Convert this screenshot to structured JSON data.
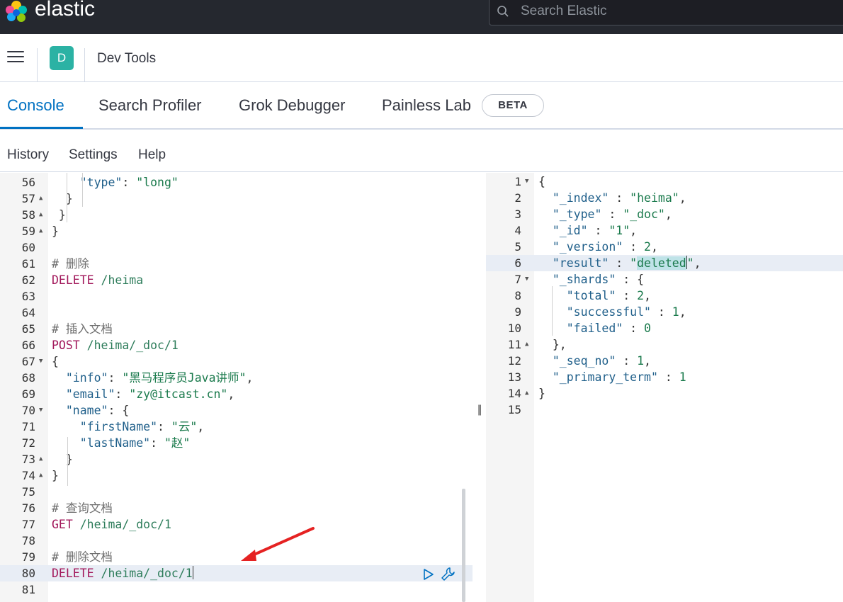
{
  "header": {
    "brand": "elastic",
    "search_placeholder": "Search Elastic"
  },
  "appbar": {
    "avatar_letter": "D",
    "title": "Dev Tools"
  },
  "tabs": [
    {
      "label": "Console",
      "active": true
    },
    {
      "label": "Search Profiler"
    },
    {
      "label": "Grok Debugger"
    },
    {
      "label": "Painless Lab"
    }
  ],
  "beta_badge": "BETA",
  "subnav": [
    "History",
    "Settings",
    "Help"
  ],
  "request_editor": {
    "lines": [
      {
        "n": "56",
        "fold": "",
        "html": "    \"type\": \"long\""
      },
      {
        "n": "57",
        "fold": "▲",
        "html": "  }"
      },
      {
        "n": "58",
        "fold": "▲",
        "html": " }"
      },
      {
        "n": "59",
        "fold": "▲",
        "html": "}"
      },
      {
        "n": "60",
        "fold": "",
        "html": ""
      },
      {
        "n": "61",
        "fold": "",
        "html": "# 删除"
      },
      {
        "n": "62",
        "fold": "",
        "html": "DELETE /heima"
      },
      {
        "n": "63",
        "fold": "",
        "html": ""
      },
      {
        "n": "64",
        "fold": "",
        "html": ""
      },
      {
        "n": "65",
        "fold": "",
        "html": "# 插入文档"
      },
      {
        "n": "66",
        "fold": "",
        "html": "POST /heima/_doc/1"
      },
      {
        "n": "67",
        "fold": "▼",
        "html": "{"
      },
      {
        "n": "68",
        "fold": "",
        "html": "  \"info\": \"黑马程序员Java讲师\","
      },
      {
        "n": "69",
        "fold": "",
        "html": "  \"email\": \"zy@itcast.cn\","
      },
      {
        "n": "70",
        "fold": "▼",
        "html": "  \"name\": {"
      },
      {
        "n": "71",
        "fold": "",
        "html": "    \"firstName\": \"云\","
      },
      {
        "n": "72",
        "fold": "",
        "html": "    \"lastName\": \"赵\""
      },
      {
        "n": "73",
        "fold": "▲",
        "html": "  }"
      },
      {
        "n": "74",
        "fold": "▲",
        "html": "}"
      },
      {
        "n": "75",
        "fold": "",
        "html": ""
      },
      {
        "n": "76",
        "fold": "",
        "html": "# 查询文档"
      },
      {
        "n": "77",
        "fold": "",
        "html": "GET /heima/_doc/1"
      },
      {
        "n": "78",
        "fold": "",
        "html": ""
      },
      {
        "n": "79",
        "fold": "",
        "html": "# 删除文档"
      },
      {
        "n": "80",
        "fold": "",
        "html": "DELETE /heima/_doc/1"
      },
      {
        "n": "81",
        "fold": "",
        "html": ""
      }
    ]
  },
  "response_editor": {
    "lines": [
      {
        "n": "1",
        "fold": "▼",
        "text": "{"
      },
      {
        "n": "2",
        "fold": "",
        "text": "  \"_index\" : \"heima\","
      },
      {
        "n": "3",
        "fold": "",
        "text": "  \"_type\" : \"_doc\","
      },
      {
        "n": "4",
        "fold": "",
        "text": "  \"_id\" : \"1\","
      },
      {
        "n": "5",
        "fold": "",
        "text": "  \"_version\" : 2,"
      },
      {
        "n": "6",
        "fold": "",
        "text": "  \"result\" : \"deleted\","
      },
      {
        "n": "7",
        "fold": "▼",
        "text": "  \"_shards\" : {"
      },
      {
        "n": "8",
        "fold": "",
        "text": "    \"total\" : 2,"
      },
      {
        "n": "9",
        "fold": "",
        "text": "    \"successful\" : 1,"
      },
      {
        "n": "10",
        "fold": "",
        "text": "    \"failed\" : 0"
      },
      {
        "n": "11",
        "fold": "▲",
        "text": "  },"
      },
      {
        "n": "12",
        "fold": "",
        "text": "  \"_seq_no\" : 1,"
      },
      {
        "n": "13",
        "fold": "",
        "text": "  \"_primary_term\" : 1"
      },
      {
        "n": "14",
        "fold": "▲",
        "text": "}"
      },
      {
        "n": "15",
        "fold": "",
        "text": ""
      }
    ]
  },
  "colors": {
    "accent": "#0071c2",
    "avatar": "#2bb2a4",
    "header_bg": "#25282f"
  }
}
